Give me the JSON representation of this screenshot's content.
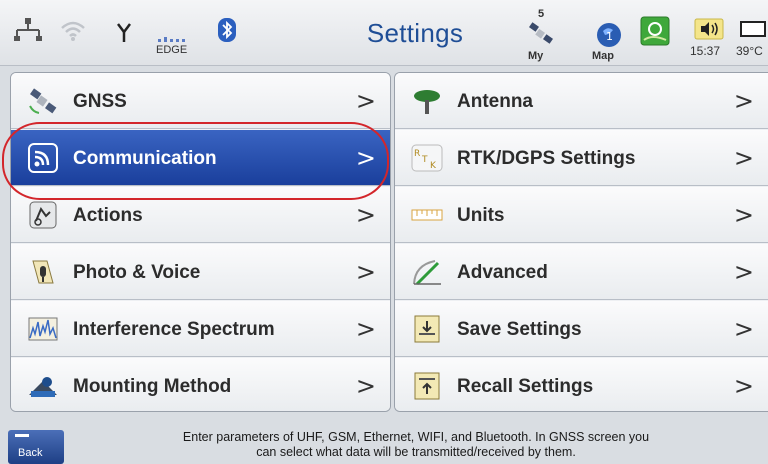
{
  "status_bar": {
    "title": "Settings",
    "network_label": "EDGE",
    "satellite_count": "5",
    "my_label": "My",
    "map_label": "Map",
    "time": "15:37",
    "temperature": "39°C",
    "icons": [
      "ethernet-icon",
      "wifi-icon",
      "antenna-icon",
      "signal-bars-icon",
      "bluetooth-icon",
      "satellite-icon",
      "globe-map-icon",
      "gps-fix-icon",
      "speaker-icon",
      "battery-icon"
    ]
  },
  "left_menu": [
    {
      "label": "GNSS",
      "icon": "satellite-icon",
      "chevron": ">",
      "selected": false
    },
    {
      "label": "Communication",
      "icon": "wireless-icon",
      "chevron": ">",
      "selected": true
    },
    {
      "label": "Actions",
      "icon": "actions-icon",
      "chevron": ">",
      "selected": false
    },
    {
      "label": "Photo & Voice",
      "icon": "camera-microphone-icon",
      "chevron": ">",
      "selected": false
    },
    {
      "label": "Interference Spectrum",
      "icon": "spectrum-icon",
      "chevron": ">",
      "selected": false
    },
    {
      "label": "Mounting Method",
      "icon": "mounting-icon",
      "chevron": ">",
      "selected": false
    }
  ],
  "right_menu": [
    {
      "label": "Antenna",
      "icon": "antenna-icon",
      "chevron": ">"
    },
    {
      "label": "RTK/DGPS Settings",
      "icon": "rtk-icon",
      "chevron": ">"
    },
    {
      "label": "Units",
      "icon": "ruler-icon",
      "chevron": ">"
    },
    {
      "label": "Advanced",
      "icon": "advanced-gauge-icon",
      "chevron": ">"
    },
    {
      "label": "Save Settings",
      "icon": "save-settings-icon",
      "chevron": ">"
    },
    {
      "label": "Recall Settings",
      "icon": "recall-settings-icon",
      "chevron": ">"
    }
  ],
  "footer": {
    "back_label": "Back",
    "hint_line1": "Enter parameters of UHF, GSM, Ethernet, WIFI, and Bluetooth. In GNSS screen you",
    "hint_line2": "can select what data will be transmitted/received by them."
  },
  "colors": {
    "title": "#1f4e96",
    "selected_row": "#1a3f9c",
    "highlight_ring": "#d3262b"
  }
}
